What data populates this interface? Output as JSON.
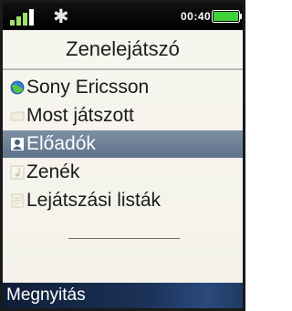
{
  "status": {
    "time": "00:40",
    "signal_icon": "signal-bars-icon",
    "bluetooth_icon": "bluetooth-icon",
    "battery_icon": "battery-icon",
    "bluetooth_glyph": "✱"
  },
  "header": {
    "title": "Zenelejátszó"
  },
  "menu": {
    "items": [
      {
        "label": "Sony Ericsson",
        "icon": "globe-icon"
      },
      {
        "label": "Most játszott",
        "icon": "folder-icon"
      },
      {
        "label": "Előadók",
        "icon": "artist-icon",
        "selected": true
      },
      {
        "label": "Zenék",
        "icon": "music-note-icon"
      },
      {
        "label": "Lejátszási listák",
        "icon": "playlist-icon"
      }
    ]
  },
  "softkeys": {
    "left": "Megnyitás"
  },
  "colors": {
    "selection": "#6b7f96",
    "softbar": "#1b3257",
    "battery_fill": "#3fd13a"
  }
}
